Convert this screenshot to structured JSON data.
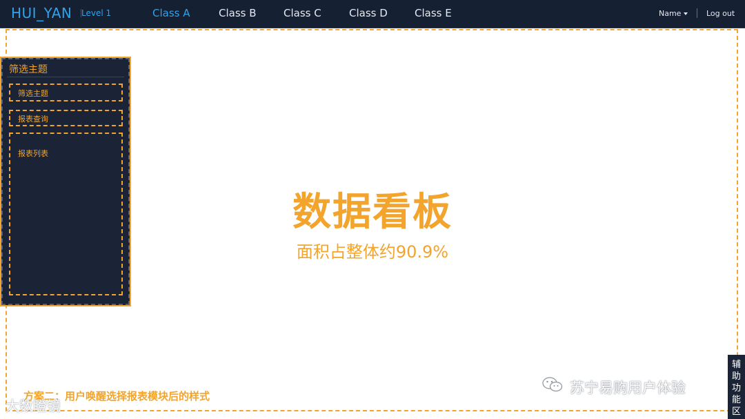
{
  "header": {
    "brand": "HUI_YAN",
    "level": "Level 1",
    "nav": [
      {
        "label": "Class A",
        "active": true
      },
      {
        "label": "Class B"
      },
      {
        "label": "Class C"
      },
      {
        "label": "Class D"
      },
      {
        "label": "Class E"
      }
    ],
    "user_name": "Name",
    "logout": "Log out"
  },
  "sidebar": {
    "title": "筛选主题",
    "items": [
      {
        "label": "筛选主题"
      },
      {
        "label": "报表查询"
      },
      {
        "label": "报表列表"
      }
    ]
  },
  "main": {
    "title": "数据看板",
    "subtitle": "面积占整体约90.9%"
  },
  "caption": "方案二：用户唤醒选择报表模块后的样式",
  "watermarks": {
    "left": "大数瞪镜",
    "right": "苏宁易购用户体验"
  },
  "aux_panel": {
    "chars": [
      "辅",
      "助",
      "功",
      "能",
      "区"
    ]
  },
  "colors": {
    "accent": "#f2a42c",
    "brand_blue": "#2fa3ea",
    "dark_bg": "#162033"
  },
  "icons": {
    "caret": "chevron-down-icon",
    "wechat": "wechat-icon"
  }
}
